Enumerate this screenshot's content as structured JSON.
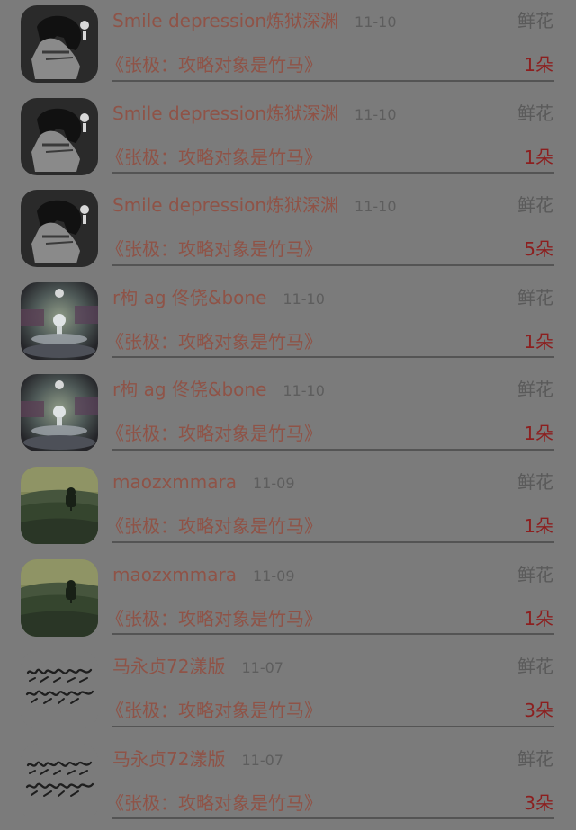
{
  "items": [
    {
      "avatar": "avatar-dark-figure",
      "name": "Smile depression炼狱深渊",
      "date": "11-10",
      "kind": "鲜花",
      "book": "《张极：攻略对象是竹马》",
      "count": "1朵"
    },
    {
      "avatar": "avatar-dark-figure",
      "name": "Smile depression炼狱深渊",
      "date": "11-10",
      "kind": "鲜花",
      "book": "《张极：攻略对象是竹马》",
      "count": "1朵"
    },
    {
      "avatar": "avatar-dark-figure",
      "name": "Smile depression炼狱深渊",
      "date": "11-10",
      "kind": "鲜花",
      "book": "《张极：攻略对象是竹马》",
      "count": "5朵"
    },
    {
      "avatar": "avatar-water-drop",
      "name": "r枸 ag 佟侥&bone",
      "date": "11-10",
      "kind": "鲜花",
      "book": "《张极：攻略对象是竹马》",
      "count": "1朵"
    },
    {
      "avatar": "avatar-water-drop",
      "name": "r枸 ag 佟侥&bone",
      "date": "11-10",
      "kind": "鲜花",
      "book": "《张极：攻略对象是竹马》",
      "count": "1朵"
    },
    {
      "avatar": "avatar-green-hill",
      "name": "maozxmmara",
      "date": "11-09",
      "kind": "鲜花",
      "book": "《张极：攻略对象是竹马》",
      "count": "1朵"
    },
    {
      "avatar": "avatar-green-hill",
      "name": "maozxmmara",
      "date": "11-09",
      "kind": "鲜花",
      "book": "《张极：攻略对象是竹马》",
      "count": "1朵"
    },
    {
      "avatar": "avatar-handwriting",
      "name": "马永贞72漾版",
      "date": "11-07",
      "kind": "鲜花",
      "book": "《张极：攻略对象是竹马》",
      "count": "3朵"
    },
    {
      "avatar": "avatar-handwriting",
      "name": "马永贞72漾版",
      "date": "11-07",
      "kind": "鲜花",
      "book": "《张极：攻略对象是竹马》",
      "count": "3朵"
    }
  ]
}
